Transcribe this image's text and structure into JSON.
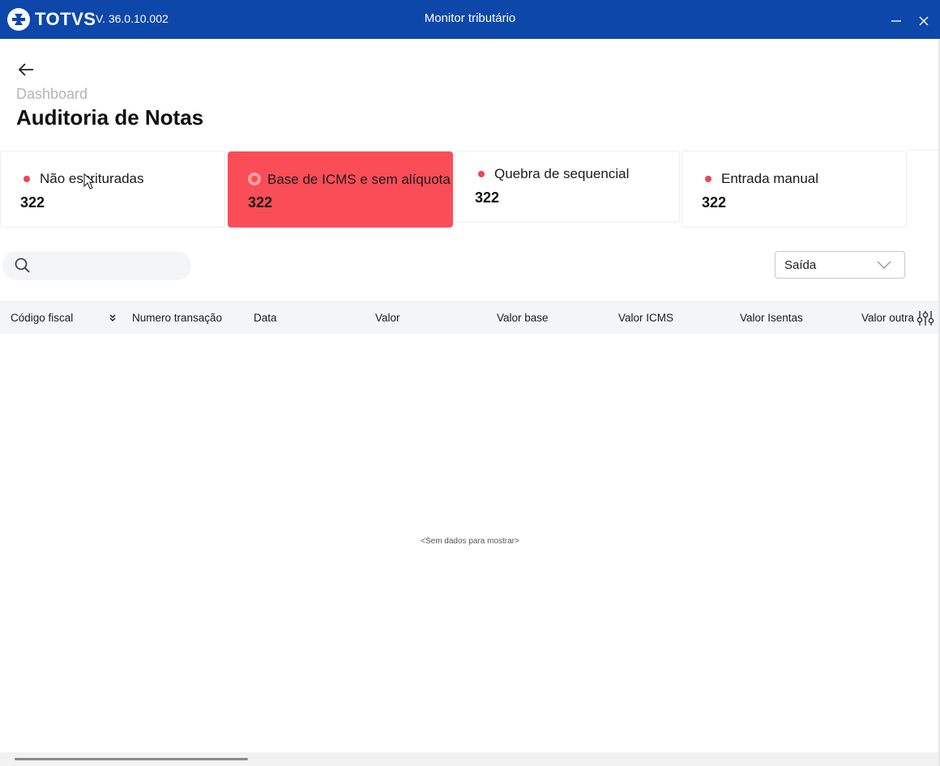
{
  "app": {
    "logo_text": "TOTVS",
    "version": "V. 36.0.10.002",
    "window_title": "Monitor tributário",
    "brand_color": "#0c47a9",
    "accent_color": "#fa4d57"
  },
  "window_controls": {
    "minimize_icon": "minimize-icon",
    "close_icon": "close-icon"
  },
  "header": {
    "back_icon": "arrow-left-icon",
    "breadcrumb": "Dashboard",
    "title": "Auditoria de Notas"
  },
  "cards": [
    {
      "label": "Não escrituradas",
      "count": "322",
      "active": false
    },
    {
      "label": "Base de ICMS e sem alíquota",
      "count": "322",
      "active": true
    },
    {
      "label": "Quebra de sequencial",
      "count": "322",
      "active": false
    },
    {
      "label": "Entrada manual",
      "count": "322",
      "active": false
    }
  ],
  "search": {
    "placeholder": "",
    "value": "",
    "icon": "search-icon"
  },
  "filter_select": {
    "value": "Saída",
    "icon": "chevron-down-icon"
  },
  "table": {
    "columns": [
      "Código fiscal",
      "Numero transação",
      "Data",
      "Valor",
      "Valor base",
      "Valor ICMS",
      "Valor Isentas",
      "Valor outra"
    ],
    "sort_icon": "double-chevron-down-icon",
    "settings_icon": "sliders-icon",
    "rows": [],
    "empty_message": "<Sem dados para mostrar>"
  }
}
